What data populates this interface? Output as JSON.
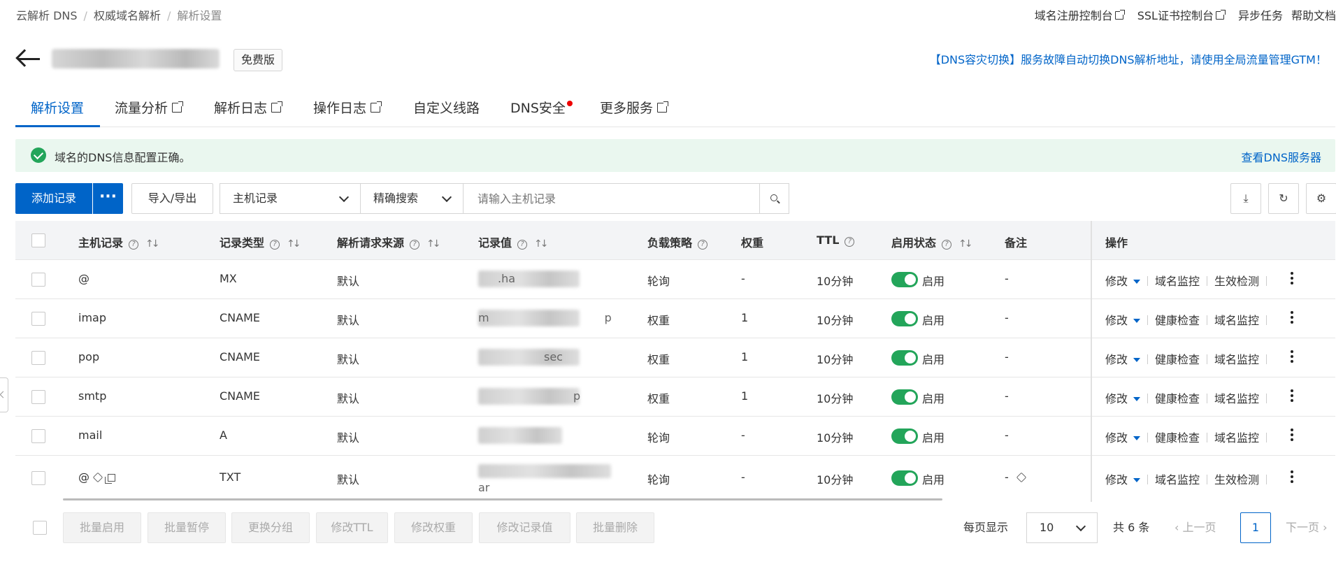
{
  "breadcrumb": [
    "云解析 DNS",
    "权威域名解析",
    "解析设置"
  ],
  "top_links": [
    "域名注册控制台",
    "SSL证书控制台",
    "异步任务",
    "帮助文档"
  ],
  "plan_badge": "免费版",
  "gtm_notice": "【DNS容灾切换】服务故障自动切换DNS解析地址，请使用全局流量管理GTM！",
  "tabs": [
    {
      "label": "解析设置"
    },
    {
      "label": "流量分析"
    },
    {
      "label": "解析日志"
    },
    {
      "label": "操作日志"
    },
    {
      "label": "自定义线路"
    },
    {
      "label": "DNS安全"
    },
    {
      "label": "更多服务"
    }
  ],
  "alert": {
    "message": "域名的DNS信息配置正确。",
    "link": "查看DNS服务器"
  },
  "toolbar": {
    "add_label": "添加记录",
    "more_label": "···",
    "import_export": "导入/导出",
    "field_select": "主机记录",
    "mode_select": "精确搜索",
    "search_placeholder": "请输入主机记录"
  },
  "columns": {
    "host": "主机记录",
    "type": "记录类型",
    "source": "解析请求来源",
    "value": "记录值",
    "policy": "负载策略",
    "weight": "权重",
    "ttl": "TTL",
    "status": "启用状态",
    "remark": "备注",
    "ops": "操作"
  },
  "rows": [
    {
      "host": "@",
      "type": "MX",
      "source": "默认",
      "value": ".ha",
      "policy": "轮询",
      "weight": "-",
      "ttl": "10分钟",
      "status": "启用",
      "remark": "-",
      "ops": [
        "修改",
        "域名监控",
        "生效检测"
      ]
    },
    {
      "host": "imap",
      "type": "CNAME",
      "source": "默认",
      "value": "m p",
      "policy": "权重",
      "weight": "1",
      "ttl": "10分钟",
      "status": "启用",
      "remark": "-",
      "ops": [
        "修改",
        "健康检查",
        "域名监控"
      ]
    },
    {
      "host": "pop",
      "type": "CNAME",
      "source": "默认",
      "value": "sec",
      "policy": "权重",
      "weight": "1",
      "ttl": "10分钟",
      "status": "启用",
      "remark": "-",
      "ops": [
        "修改",
        "健康检查",
        "域名监控"
      ]
    },
    {
      "host": "smtp",
      "type": "CNAME",
      "source": "默认",
      "value": "p",
      "policy": "权重",
      "weight": "1",
      "ttl": "10分钟",
      "status": "启用",
      "remark": "-",
      "ops": [
        "修改",
        "健康检查",
        "域名监控"
      ]
    },
    {
      "host": "mail",
      "type": "A",
      "source": "默认",
      "value": "",
      "policy": "轮询",
      "weight": "-",
      "ttl": "10分钟",
      "status": "启用",
      "remark": "-",
      "ops": [
        "修改",
        "健康检查",
        "域名监控"
      ]
    },
    {
      "host": "@",
      "type": "TXT",
      "source": "默认",
      "value": "ar",
      "policy": "轮询",
      "weight": "-",
      "ttl": "10分钟",
      "status": "启用",
      "remark": "-",
      "ops": [
        "修改",
        "域名监控",
        "生效检测"
      ]
    }
  ],
  "batch_buttons": [
    "批量启用",
    "批量暂停",
    "更换分组",
    "修改TTL",
    "修改权重",
    "修改记录值",
    "批量删除"
  ],
  "pagination": {
    "per_page_label": "每页显示",
    "per_page": "10",
    "total": "共 6 条",
    "prev": "上一页",
    "current": "1",
    "next": "下一页"
  },
  "colors": {
    "primary": "#0064c8",
    "success": "#23a55a",
    "alert_bg": "#eaf7ef"
  }
}
